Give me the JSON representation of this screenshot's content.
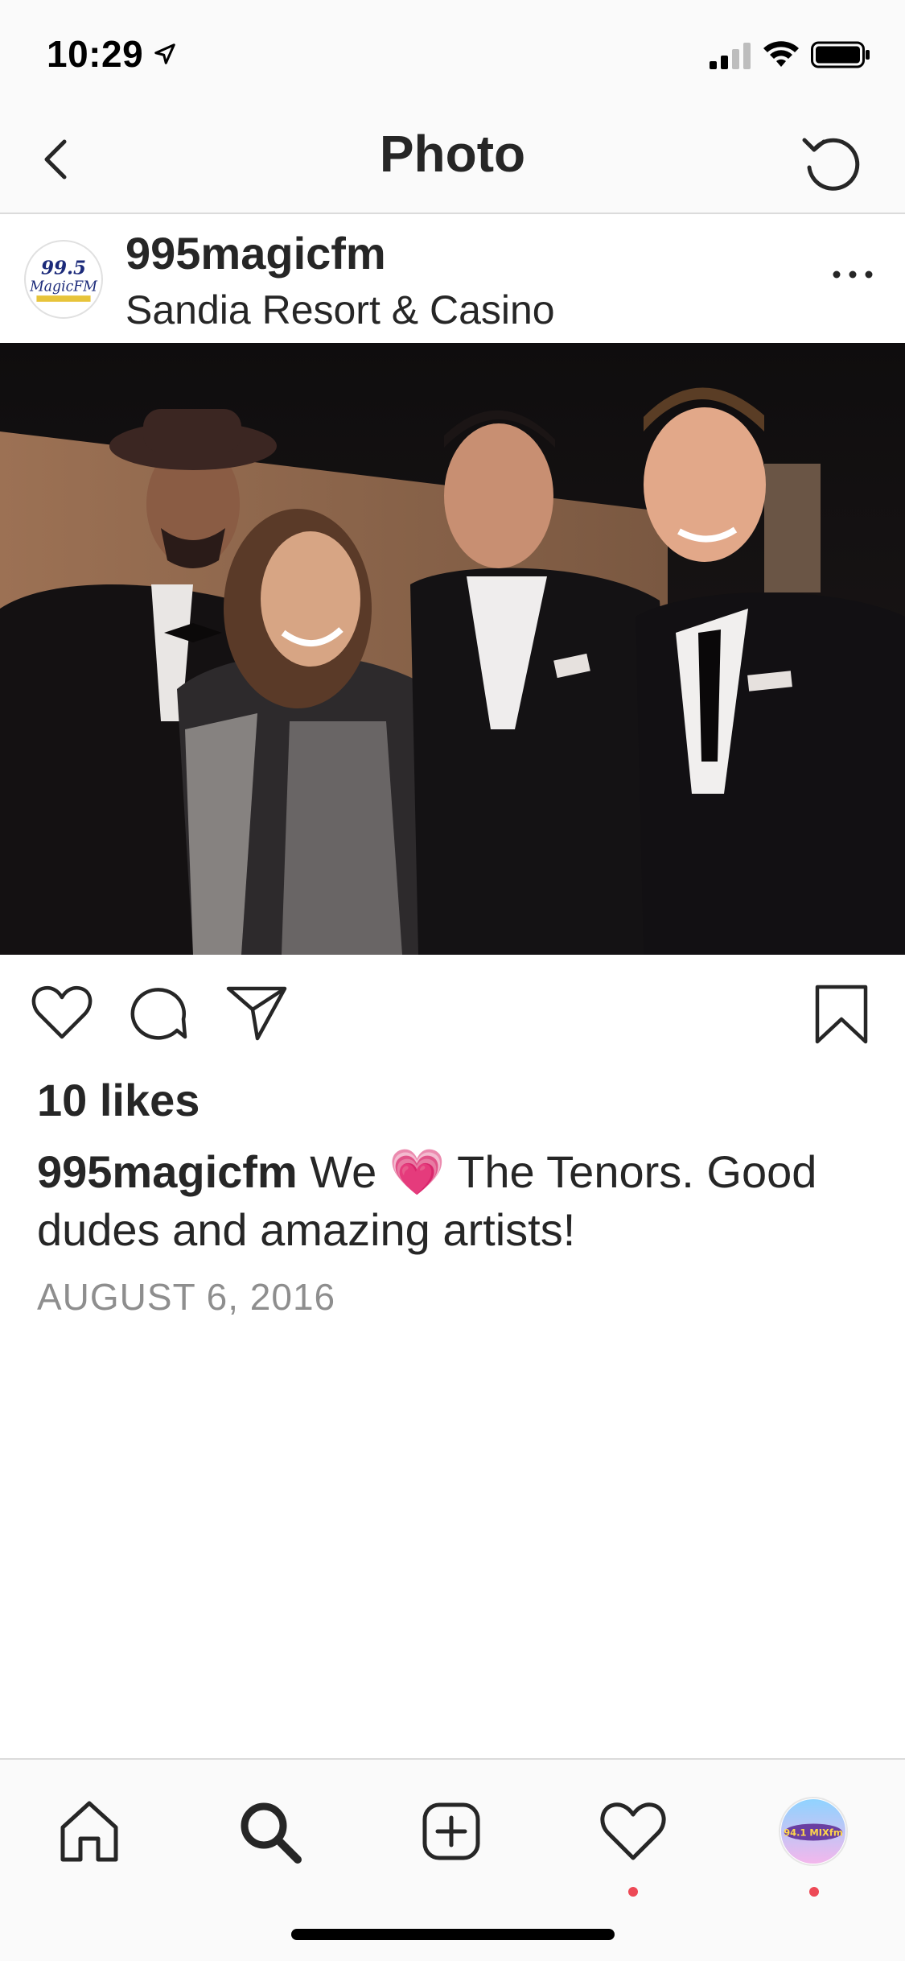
{
  "status_bar": {
    "time": "10:29",
    "icons": [
      "location-arrow-icon",
      "signal-icon",
      "wifi-icon",
      "battery-icon"
    ]
  },
  "nav": {
    "title": "Photo",
    "back_icon": "chevron-left-icon",
    "refresh_icon": "refresh-icon"
  },
  "post": {
    "avatar_logo_text": "99.5 MagicFM",
    "username": "995magicfm",
    "location": "Sandia Resort & Casino",
    "more_icon": "ellipsis-icon",
    "image_icon": "photo",
    "likes": "10 likes",
    "caption_user": "995magicfm",
    "caption_pre": "We",
    "caption_emoji": "💗",
    "caption_post": "The Tenors. Good dudes and amazing artists!",
    "date": "AUGUST 6, 2016"
  },
  "actions": {
    "icons": [
      "heart-icon",
      "comment-icon",
      "paper-plane-icon",
      "bookmark-icon"
    ]
  },
  "tab_bar": {
    "icons": [
      "home-icon",
      "search-icon",
      "plus-square-icon",
      "heart-icon",
      "profile-avatar"
    ],
    "profile_logo_text": "94.1 MIXfm",
    "notification_color": "#ed4956"
  },
  "colors": {
    "text": "#262626",
    "secondary": "#8e8e8e",
    "bar_background": "#fafafa",
    "divider": "#dbdbdb"
  }
}
